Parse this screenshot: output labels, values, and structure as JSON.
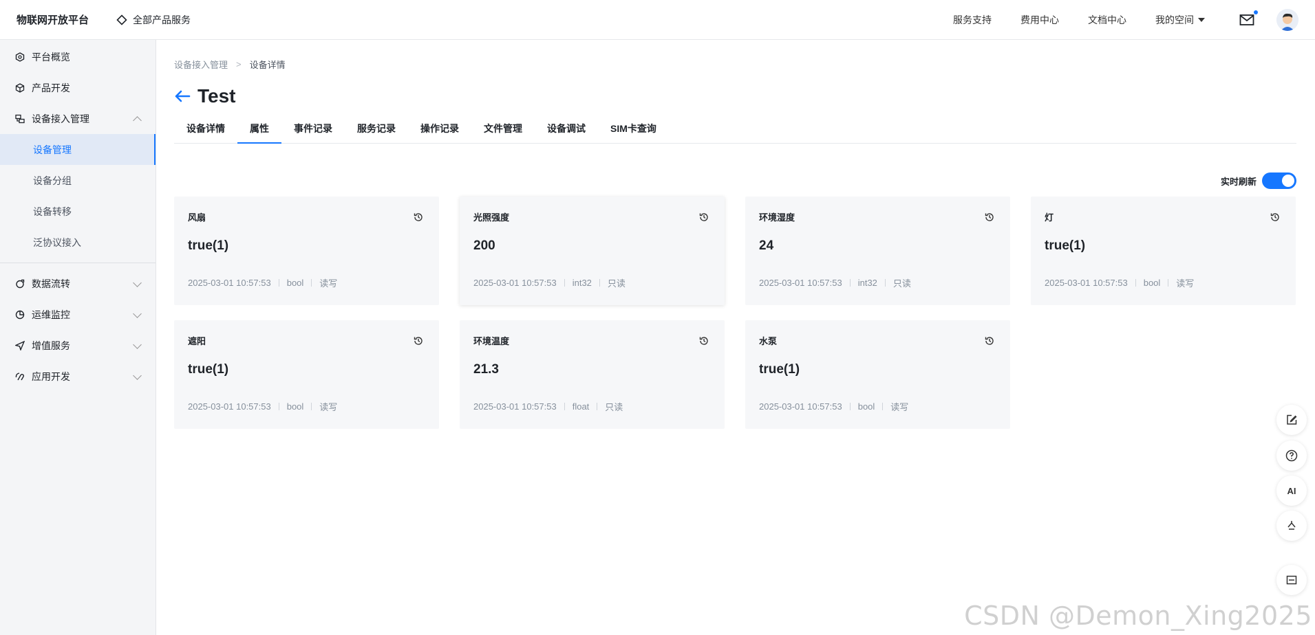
{
  "header": {
    "brand": "物联网开放平台",
    "all_products": "全部产品服务",
    "nav": [
      "服务支持",
      "费用中心",
      "文档中心"
    ],
    "my_space": "我的空间"
  },
  "sidebar": {
    "items": [
      {
        "label": "平台概览",
        "icon": "hexagon-icon"
      },
      {
        "label": "产品开发",
        "icon": "cube-icon"
      },
      {
        "label": "设备接入管理",
        "icon": "device-access-icon"
      }
    ],
    "subitems": [
      "设备管理",
      "设备分组",
      "设备转移",
      "泛协议接入"
    ],
    "items2": [
      {
        "label": "数据流转",
        "icon": "data-flow-icon"
      },
      {
        "label": "运维监控",
        "icon": "monitor-icon"
      },
      {
        "label": "增值服务",
        "icon": "send-icon"
      },
      {
        "label": "应用开发",
        "icon": "app-dev-icon"
      }
    ]
  },
  "breadcrumb": [
    "设备接入管理",
    ">",
    "设备详情"
  ],
  "title": "Test",
  "tabs": [
    "设备详情",
    "属性",
    "事件记录",
    "服务记录",
    "操作记录",
    "文件管理",
    "设备调试",
    "SIM卡查询"
  ],
  "refresh_label": "实时刷新",
  "cards": [
    {
      "name": "风扇",
      "value": "true(1)",
      "time": "2025-03-01 10:57:53",
      "type": "bool",
      "access": "读写"
    },
    {
      "name": "光照强度",
      "value": "200",
      "time": "2025-03-01 10:57:53",
      "type": "int32",
      "access": "只读"
    },
    {
      "name": "环境湿度",
      "value": "24",
      "time": "2025-03-01 10:57:53",
      "type": "int32",
      "access": "只读"
    },
    {
      "name": "灯",
      "value": "true(1)",
      "time": "2025-03-01 10:57:53",
      "type": "bool",
      "access": "读写"
    },
    {
      "name": "遮阳",
      "value": "true(1)",
      "time": "2025-03-01 10:57:53",
      "type": "bool",
      "access": "读写"
    },
    {
      "name": "环境温度",
      "value": "21.3",
      "time": "2025-03-01 10:57:53",
      "type": "float",
      "access": "只读"
    },
    {
      "name": "水泵",
      "value": "true(1)",
      "time": "2025-03-01 10:57:53",
      "type": "bool",
      "access": "读写"
    }
  ],
  "floating": {
    "ai": "AI"
  },
  "watermark": "CSDN @Demon_Xing2025",
  "colors": {
    "accent": "#1677ff",
    "card_bg": "#f6f7f9",
    "sidebar_active_bg": "#e1e9f6"
  }
}
